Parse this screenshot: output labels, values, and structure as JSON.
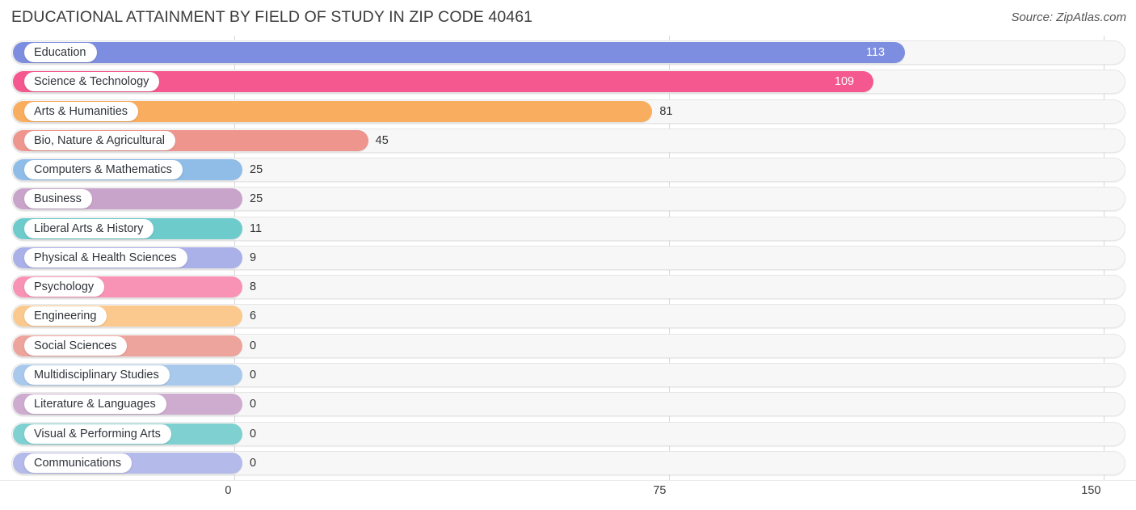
{
  "header": {
    "title": "EDUCATIONAL ATTAINMENT BY FIELD OF STUDY IN ZIP CODE 40461",
    "source": "Source: ZipAtlas.com"
  },
  "chart_data": {
    "type": "bar",
    "orientation": "horizontal",
    "title": "EDUCATIONAL ATTAINMENT BY FIELD OF STUDY IN ZIP CODE 40461",
    "xlabel": "",
    "ylabel": "",
    "xlim": [
      0,
      150
    ],
    "xticks": [
      0,
      75,
      150
    ],
    "xtick_labels": [
      "0",
      "75",
      "150"
    ],
    "grid": true,
    "legend": null,
    "categories": [
      "Education",
      "Science & Technology",
      "Arts & Humanities",
      "Bio, Nature & Agricultural",
      "Computers & Mathematics",
      "Business",
      "Liberal Arts & History",
      "Physical & Health Sciences",
      "Psychology",
      "Engineering",
      "Social Sciences",
      "Multidisciplinary Studies",
      "Literature & Languages",
      "Visual & Performing Arts",
      "Communications"
    ],
    "values": [
      113,
      109,
      81,
      45,
      25,
      25,
      11,
      9,
      8,
      6,
      0,
      0,
      0,
      0,
      0
    ],
    "value_labels": [
      "113",
      "109",
      "81",
      "45",
      "25",
      "25",
      "11",
      "9",
      "8",
      "6",
      "0",
      "0",
      "0",
      "0",
      "0"
    ],
    "colors": [
      "#7d8ee0",
      "#f4588e",
      "#f9ad5e",
      "#ee968e",
      "#8fbde8",
      "#c9a4ca",
      "#6ecbcc",
      "#aab0e8",
      "#f893b5",
      "#fbc88e",
      "#eda49c",
      "#a9c9ec",
      "#cdacd0",
      "#7fd0d0",
      "#b4bae9"
    ],
    "label_inside": [
      true,
      true,
      false,
      false,
      false,
      false,
      false,
      false,
      false,
      false,
      false,
      false,
      false,
      false,
      false
    ]
  }
}
